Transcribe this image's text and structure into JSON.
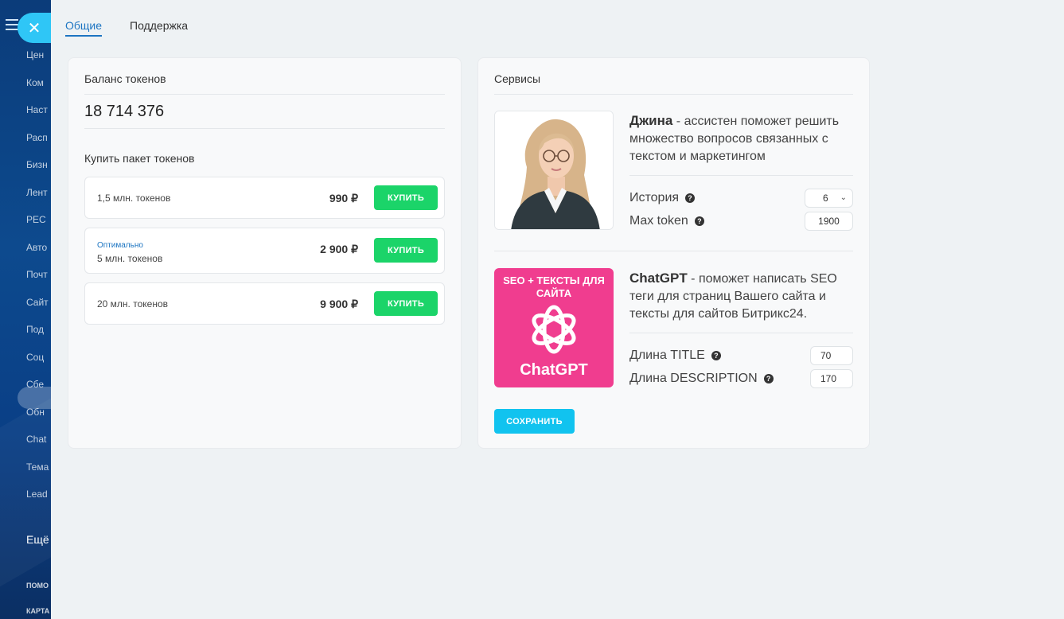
{
  "sidebar": {
    "items": [
      "Цен",
      "Ком",
      "Наст",
      "Расп",
      "Бизн",
      "Лент",
      "РЕС",
      "Авто",
      "Почт",
      "Сайт",
      "Под",
      "Соц",
      "Сбе",
      "Обн",
      "Chat",
      "Тема",
      "Lead"
    ],
    "more_label": "Ещё",
    "help_label": "ПОМО",
    "map_label": "КАРТА"
  },
  "tabs": [
    {
      "label": "Общие",
      "active": true
    },
    {
      "label": "Поддержка",
      "active": false
    }
  ],
  "tokens": {
    "balance_title": "Баланс токенов",
    "balance_value": "18 714 376",
    "buy_title": "Купить пакет токенов",
    "packs": [
      {
        "tag": "",
        "label": "1,5 млн. токенов",
        "price": "990 ₽",
        "button": "КУПИТЬ"
      },
      {
        "tag": "Оптимально",
        "label": "5 млн. токенов",
        "price": "2 900 ₽",
        "button": "КУПИТЬ"
      },
      {
        "tag": "",
        "label": "20 млн. токенов",
        "price": "9 900 ₽",
        "button": "КУПИТЬ"
      }
    ]
  },
  "services": {
    "title": "Сервисы",
    "gina": {
      "name": "Джина",
      "description": " - ассистен поможет решить множество вопросов связанных с текстом и маркетингом",
      "params": [
        {
          "label": "История",
          "value": "6"
        },
        {
          "label": "Max token",
          "value": "1900"
        }
      ]
    },
    "chatgpt": {
      "name": "ChatGPT",
      "description": " - поможет написать SEO теги для страниц Вашего сайта и тексты для сайтов Битрикс24.",
      "image_top_text": "SEO + ТЕКСТЫ ДЛЯ САЙТА",
      "image_bottom_text": "ChatGPT",
      "params": [
        {
          "label": "Длина TITLE",
          "value": "70"
        },
        {
          "label": "Длина DESCRIPTION",
          "value": "170"
        }
      ]
    },
    "save_label": "СОХРАНИТЬ"
  },
  "colors": {
    "accent": "#1d75c2",
    "buy_button": "#1bd469",
    "save_button": "#11c3ef",
    "close_button": "#2fc6f6",
    "gpt_image_bg": "#f03d8f"
  }
}
